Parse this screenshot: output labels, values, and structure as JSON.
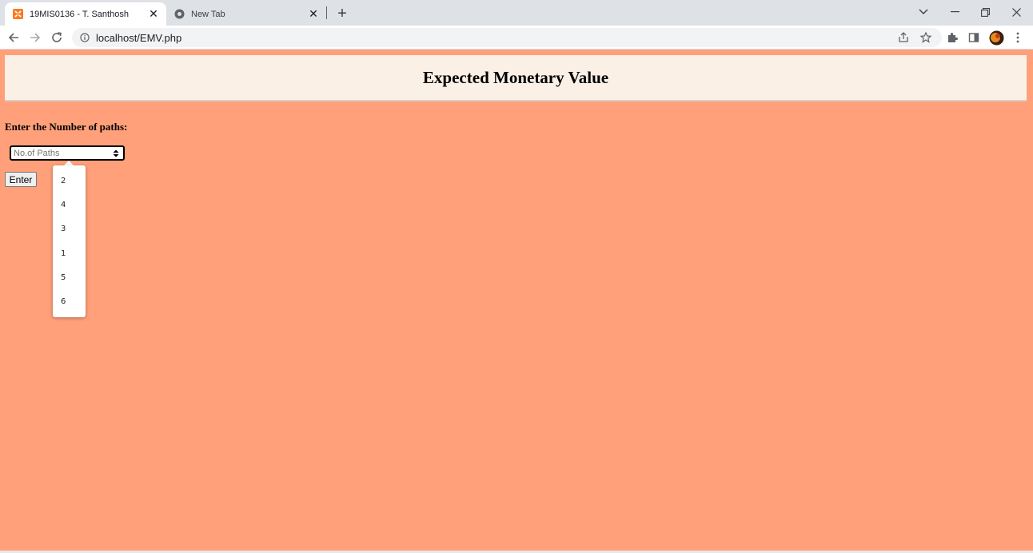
{
  "browser": {
    "tabs": [
      {
        "title": "19MIS0136 - T. Santhosh",
        "favicon": "xampp-icon",
        "active": true
      },
      {
        "title": "New Tab",
        "favicon": "chrome-icon",
        "active": false
      }
    ],
    "url": "localhost/EMV.php"
  },
  "page": {
    "heading": "Expected Monetary Value",
    "prompt": "Enter the Number of paths:",
    "select_placeholder": "No.of Paths",
    "enter_label": "Enter",
    "dropdown_options": [
      "2",
      "4",
      "3",
      "1",
      "5",
      "6"
    ],
    "background_color": "#ffa07a",
    "header_color": "#faf0e6"
  }
}
